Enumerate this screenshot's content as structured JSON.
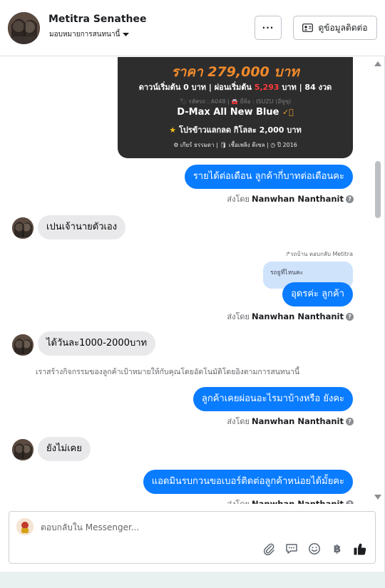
{
  "header": {
    "contact_name": "Metitra Senathee",
    "assign_label": "มอบหมายการสนทนานี้",
    "contact_button_label": "ดูข้อมูลติดต่อ",
    "more_label": "···"
  },
  "card": {
    "price": "ราคา 279,000 บาท",
    "terms_prefix": "ดาวน์เริ่มต้น 0 บาท | ผ่อนเริ่มต้น ",
    "terms_red": "5,293",
    "terms_suffix": " บาท | 84 งวด",
    "meta": "🏷 รหัสรถ : A048 | 🚘 ยี่ห้อ : ISUZU (อีซูซุ)",
    "model": "D-Max All New Blue",
    "promo": "โปรข้าวแลกลด กิโลละ 2,000 บาท",
    "specs": "⚙ เกียร์ ธรรมดา   |   🛢 เชื้อเพลิง ดีเซล   |   ◷ ปี 2016"
  },
  "messages": {
    "m1": "รายได้ต่อเดือน ลูกค้ากี่บาทต่อเดือนคะ",
    "in1": "เปนเจ้านายตัวเอง",
    "reply_label": "รถบ้าน ตอบกลับ Metitra",
    "quoted": "รถยูที่ไหนคะ",
    "m2": "อุดรค่ะ ลูกค้า",
    "in2": "ได้วันละ1000-2000บาท",
    "system_note": "เราสร้างกิจกรรมของลูกค้าเป้าหมายให้กับคุณโดยอัตโนมัติโดยอิงตามการสนทนานี้",
    "m3": "ลูกค้าเคยผ่อนอะไรมาบ้างหรือ ยังคะ",
    "in3": "ยังไม่เคย",
    "m4": "แอดมินรบกวนขอเบอร์ติดต่อลูกค้าหน่อยได้มั้ยคะ"
  },
  "sent_by": {
    "prefix": "ส่งโดย",
    "name": "Nanwhan Nanthanit"
  },
  "composer": {
    "placeholder": "ตอบกลับใน Messenger..."
  },
  "icons": {
    "attach": "paperclip-icon",
    "saved_replies": "chat-bubble-icon",
    "emoji": "smile-icon",
    "payment": "baht-icon",
    "like": "thumbs-up-icon"
  },
  "colors": {
    "outgoing": "#0a7cff",
    "incoming": "#e9e9eb",
    "price": "#f08a2c"
  }
}
